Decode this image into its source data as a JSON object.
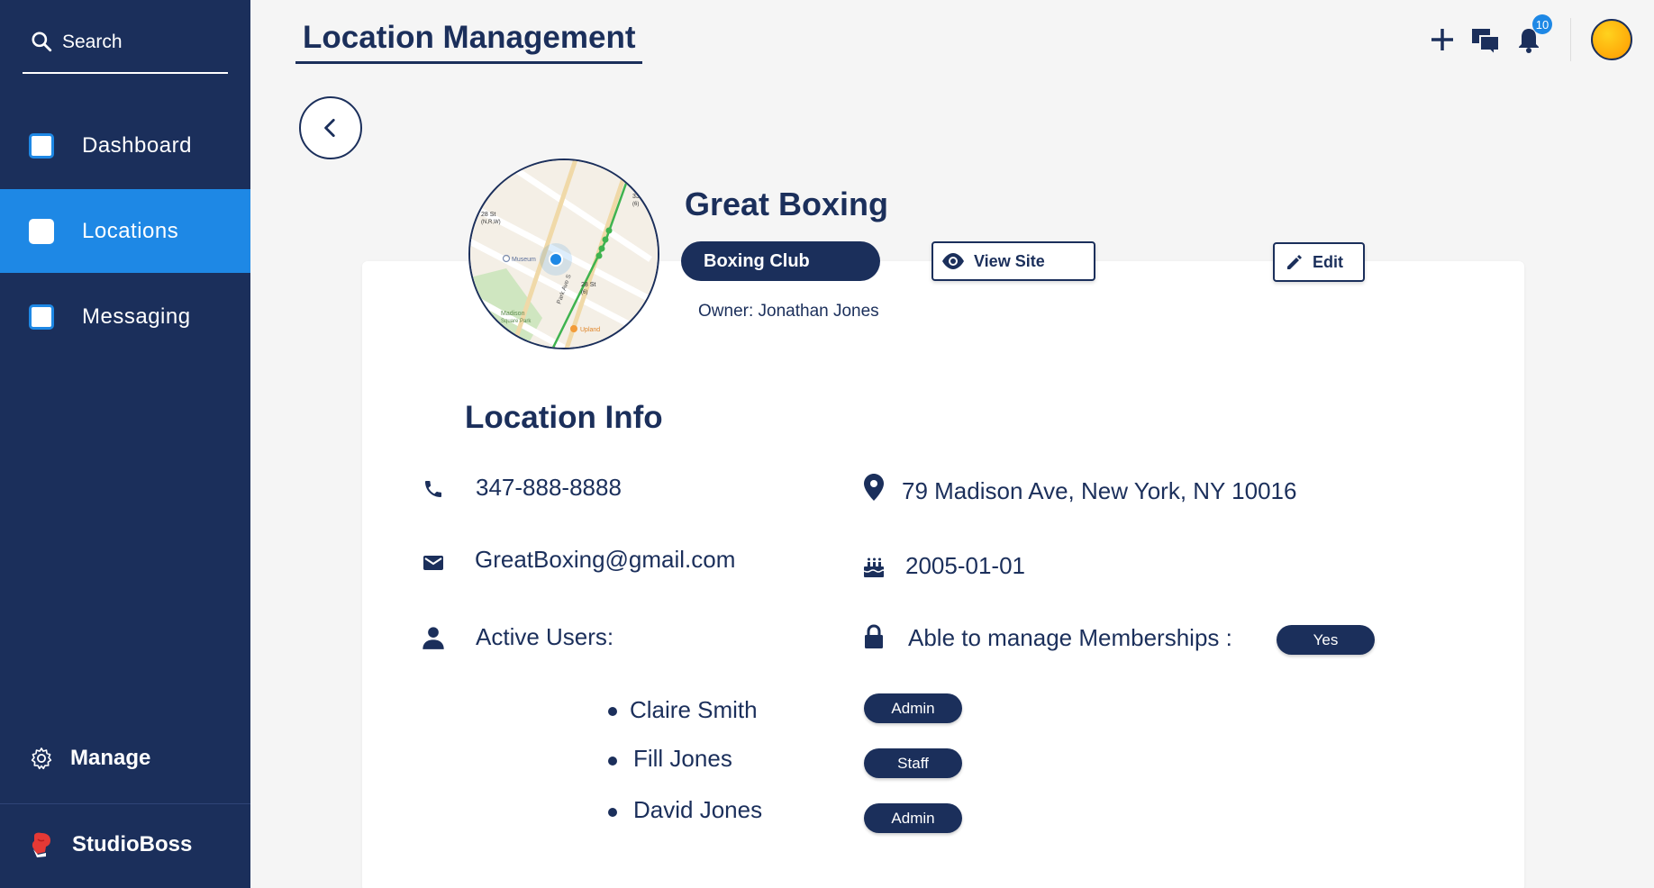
{
  "sidebar": {
    "search_label": "Search",
    "items": [
      {
        "label": "Dashboard"
      },
      {
        "label": "Locations"
      },
      {
        "label": "Messaging"
      }
    ],
    "manage_label": "Manage",
    "brand_label": "StudioBoss"
  },
  "header": {
    "title": "Location Management",
    "notification_count": "10"
  },
  "location": {
    "name": "Great Boxing",
    "type": "Boxing Club",
    "view_site_label": "View Site",
    "edit_label": "Edit",
    "owner": "Owner: Jonathan Jones"
  },
  "info": {
    "title": "Location Info",
    "phone": "347-888-8888",
    "email": "GreatBoxing@gmail.com",
    "address": "79 Madison Ave,  New York, NY 10016",
    "date": "2005-01-01",
    "active_users_label": "Active Users:",
    "memberships_label": "Able to manage Memberships :",
    "memberships_value": "Yes",
    "users": [
      {
        "name": "Claire Smith",
        "role": "Admin"
      },
      {
        "name": "Fill Jones",
        "role": "Staff"
      },
      {
        "name": "David Jones",
        "role": "Admin"
      }
    ]
  },
  "map_labels": {
    "st28a": "28 St",
    "st28a_sub": "(N,R,W)",
    "museum": "Museum",
    "st28b": "28 St",
    "st28b_sub": "(6)",
    "madison": "Madison",
    "madison_sub": "Square Park",
    "upland": "Upland",
    "park_ave": "Park Ave S",
    "st33": "33",
    "st33_sub": "(6)"
  },
  "colors": {
    "navy": "#1b2f5b",
    "accent": "#1e88e5"
  }
}
